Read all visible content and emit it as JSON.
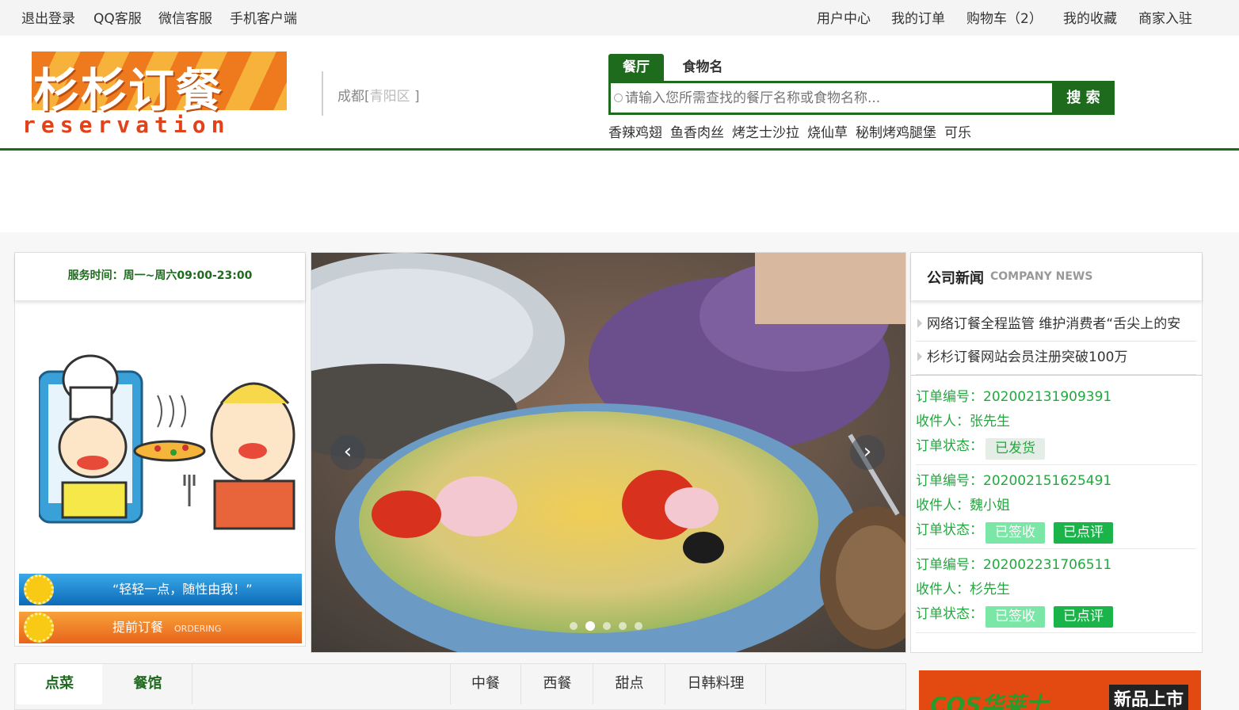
{
  "topbar": {
    "left": [
      "退出登录",
      "QQ客服",
      "微信客服",
      "手机客户端"
    ],
    "right": [
      "用户中心",
      "我的订单",
      "购物车（2）",
      "我的收藏",
      "商家入驻"
    ]
  },
  "logo": {
    "cn": "杉杉订餐",
    "en": "reservation"
  },
  "location": {
    "city": "成都[",
    "district": "青阳区",
    "close": " ]"
  },
  "search": {
    "tabs": [
      "餐厅",
      "食物名"
    ],
    "placeholder": "请输入您所需查找的餐厅名称或食物名称...",
    "button": "搜 索",
    "hot": [
      "香辣鸡翅",
      "鱼香肉丝",
      "烤芝士沙拉",
      "烧仙草",
      "秘制烤鸡腿堡",
      "可乐"
    ]
  },
  "left": {
    "service": "服务时间：周一~周六09:00-23:00",
    "promo1": "“轻轻一点，随性由我！”",
    "promo2": "提前订餐",
    "promo2_en": "ORDERING"
  },
  "slider": {
    "prev": "‹",
    "next": "›",
    "dots": 5,
    "active": 1
  },
  "news": {
    "title": "公司新闻",
    "title_en": "COMPANY NEWS",
    "items": [
      "网络订餐全程监管 维护消费者“舌尖上的安",
      "杉杉订餐网站会员注册突破100万"
    ]
  },
  "orders": [
    {
      "no_label": "订单编号：",
      "no": "202002131909391",
      "recv_label": "收件人：",
      "recv": "张先生",
      "status_label": "订单状态：",
      "tags": [
        "已发货"
      ]
    },
    {
      "no_label": "订单编号：",
      "no": "202002151625491",
      "recv_label": "收件人：",
      "recv": "魏小姐",
      "status_label": "订单状态：",
      "tags": [
        "已签收",
        "已点评"
      ]
    },
    {
      "no_label": "订单编号：",
      "no": "202002231706511",
      "recv_label": "收件人：",
      "recv": "杉先生",
      "status_label": "订单状态：",
      "tags": [
        "已签收",
        "已点评"
      ]
    }
  ],
  "bottomtabs": {
    "main": [
      "点菜",
      "餐馆"
    ],
    "cats": [
      "中餐",
      "西餐",
      "甜点",
      "日韩料理"
    ]
  },
  "ad": {
    "brand": "COS华莱士",
    "badge": "新品上市"
  },
  "colors": {
    "brand_green": "#1e6b1e",
    "order_green": "#25a640"
  }
}
